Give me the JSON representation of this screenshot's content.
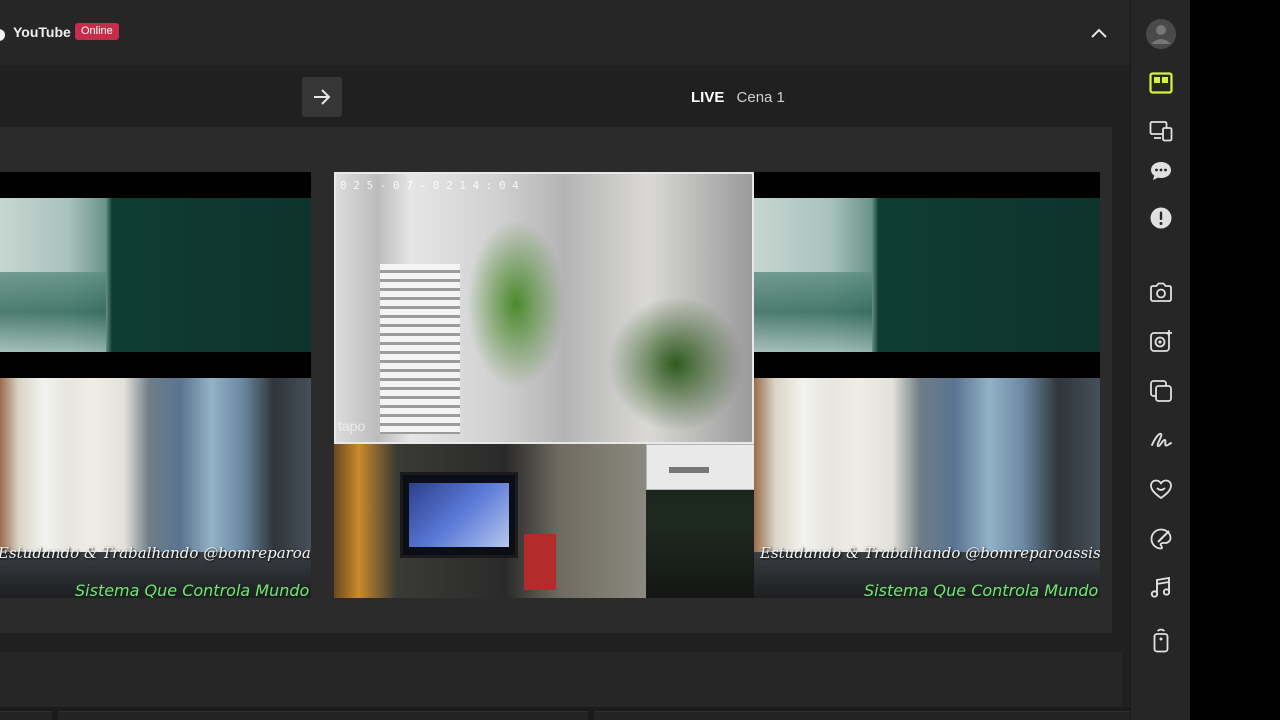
{
  "platform": {
    "name": "YouTube",
    "status": "Online"
  },
  "header": {
    "live_label": "LIVE",
    "scene_name": "Cena 1"
  },
  "preview": {
    "left_pane": {
      "overlay_text": "Estudando & Trabalhando @bomreparoassistencia",
      "overlay_green": "Sistema Que Controla Mundo"
    },
    "right_pane": {
      "overlay_text": "Estudando & Trabalhando @bomreparoassistencia",
      "overlay_green": "Sistema Que Controla Mundo"
    },
    "center_pane": {
      "camera_timestamp": "0 2 5 - 0 7 - 0 2   1 4 : 0 4",
      "camera_watermark": "tapo"
    }
  },
  "sidebar": {
    "items": [
      {
        "icon": "user-avatar-icon"
      },
      {
        "icon": "layout-editor-icon",
        "active": true
      },
      {
        "icon": "devices-icon"
      },
      {
        "icon": "chat-icon"
      },
      {
        "icon": "alert-icon"
      },
      {
        "icon": "camera-icon"
      },
      {
        "icon": "replay-capture-icon"
      },
      {
        "icon": "layers-icon"
      },
      {
        "icon": "signature-icon"
      },
      {
        "icon": "heart-icon"
      },
      {
        "icon": "brush-icon"
      },
      {
        "icon": "music-icon"
      },
      {
        "icon": "remote-icon"
      }
    ]
  },
  "colors": {
    "accent": "#d7f33b",
    "badge": "#c72c4a",
    "overlay_green": "#79e07a"
  }
}
